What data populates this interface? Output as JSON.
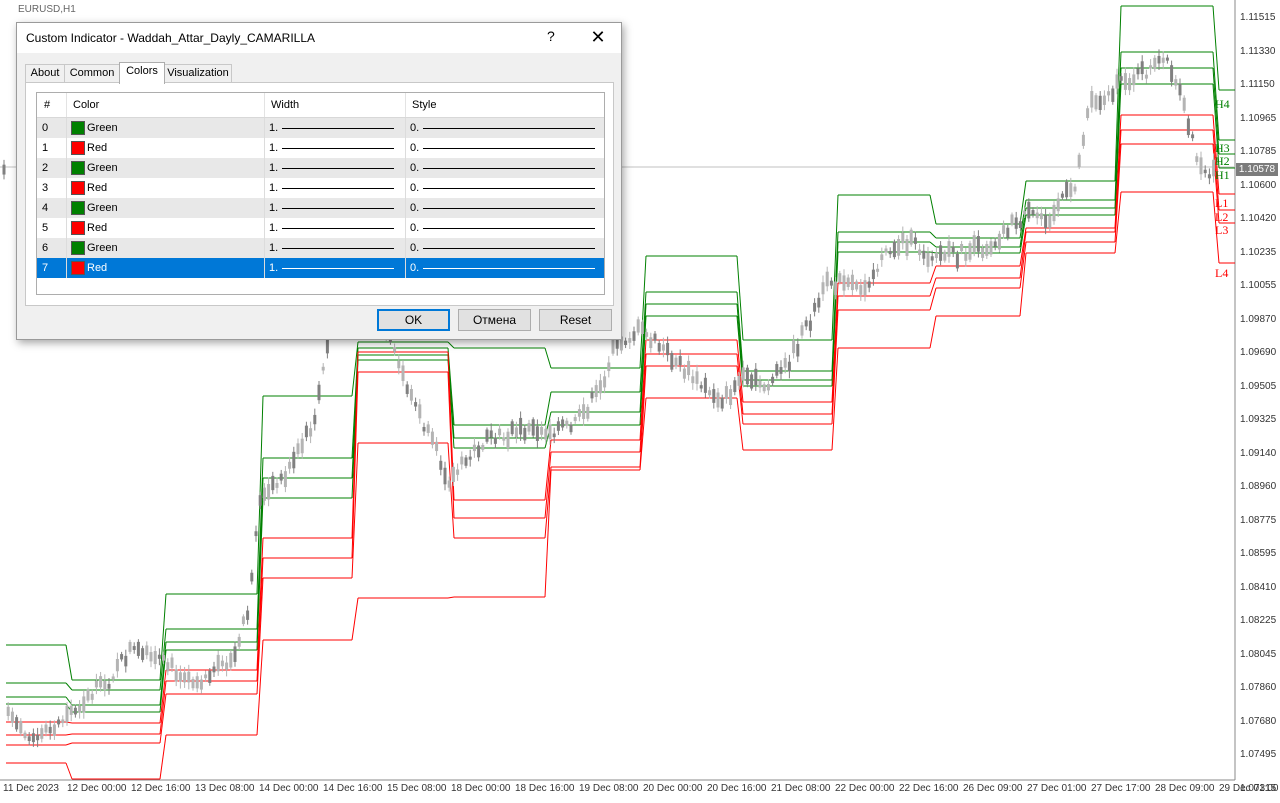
{
  "chart": {
    "symbol_timeframe": "EURUSD,H1",
    "current_price": "1.10578",
    "price_scale": [
      "1.11515",
      "1.11330",
      "1.11150",
      "1.10965",
      "1.10785",
      "1.10600",
      "1.10420",
      "1.10235",
      "1.10055",
      "1.09870",
      "1.09690",
      "1.09505",
      "1.09325",
      "1.09140",
      "1.08960",
      "1.08775",
      "1.08595",
      "1.08410",
      "1.08225",
      "1.08045",
      "1.07860",
      "1.07680",
      "1.07495",
      "1.07315"
    ],
    "time_scale": [
      "11 Dec 2023",
      "12 Dec 00:00",
      "12 Dec 16:00",
      "13 Dec 08:00",
      "14 Dec 00:00",
      "14 Dec 16:00",
      "15 Dec 08:00",
      "18 Dec 00:00",
      "18 Dec 16:00",
      "19 Dec 08:00",
      "20 Dec 00:00",
      "20 Dec 16:00",
      "21 Dec 08:00",
      "22 Dec 00:00",
      "22 Dec 16:00",
      "26 Dec 09:00",
      "27 Dec 01:00",
      "27 Dec 17:00",
      "28 Dec 09:00",
      "29 Dec 01:00"
    ],
    "level_tags": [
      "H4",
      "H3",
      "H2",
      "H1",
      "L1",
      "L2",
      "L3",
      "L4"
    ],
    "colors": {
      "resistance": "#008000",
      "support": "#ff0000",
      "candle": "#b4b4b4",
      "dark_candle": "#808080"
    }
  },
  "dialog": {
    "title": "Custom Indicator - Waddah_Attar_Dayly_CAMARILLA",
    "help": "?",
    "close": "✕",
    "tabs": [
      "About",
      "Common",
      "Colors",
      "Visualization"
    ],
    "active_tab": "Colors",
    "columns": [
      "#",
      "Color",
      "Width",
      "Style"
    ],
    "rows": [
      {
        "index": "0",
        "color_name": "Green",
        "color": "#008000",
        "width": "1.",
        "style": "0."
      },
      {
        "index": "1",
        "color_name": "Red",
        "color": "#ff0000",
        "width": "1.",
        "style": "0."
      },
      {
        "index": "2",
        "color_name": "Green",
        "color": "#008000",
        "width": "1.",
        "style": "0."
      },
      {
        "index": "3",
        "color_name": "Red",
        "color": "#ff0000",
        "width": "1.",
        "style": "0."
      },
      {
        "index": "4",
        "color_name": "Green",
        "color": "#008000",
        "width": "1.",
        "style": "0."
      },
      {
        "index": "5",
        "color_name": "Red",
        "color": "#ff0000",
        "width": "1.",
        "style": "0."
      },
      {
        "index": "6",
        "color_name": "Green",
        "color": "#008000",
        "width": "1.",
        "style": "0."
      },
      {
        "index": "7",
        "color_name": "Red",
        "color": "#ff0000",
        "width": "1.",
        "style": "0."
      }
    ],
    "selected_row": "7",
    "buttons": {
      "ok": "OK",
      "cancel": "Отмена",
      "reset": "Reset"
    }
  }
}
